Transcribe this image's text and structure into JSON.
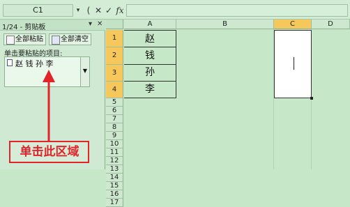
{
  "formula_bar": {
    "name_box": "C1",
    "name_box_arrow": "▾",
    "paren": "(",
    "cancel": "✕",
    "enter": "✓",
    "fx": "fx"
  },
  "clipboard": {
    "title": "1/24 - 剪贴板",
    "menu_arrow": "▾",
    "close": "✕",
    "paste_all": "全部粘贴",
    "clear_all": "全部清空",
    "instruction": "单击要粘贴的项目:",
    "item_text": "赵 钱 孙 李",
    "item_dropdown": "▼"
  },
  "annotation": {
    "text": "单击此区域"
  },
  "columns": [
    "A",
    "B",
    "C",
    "D"
  ],
  "rows": [
    "1",
    "2",
    "3",
    "4",
    "5",
    "6",
    "7",
    "8",
    "9",
    "10",
    "11",
    "12",
    "13",
    "14",
    "15",
    "16",
    "17"
  ],
  "cells_a": [
    "赵",
    "钱",
    "孙",
    "李"
  ],
  "colors": {
    "accent": "#e0242a",
    "selected_header": "#f6c75a",
    "background": "#c7e8c8"
  }
}
